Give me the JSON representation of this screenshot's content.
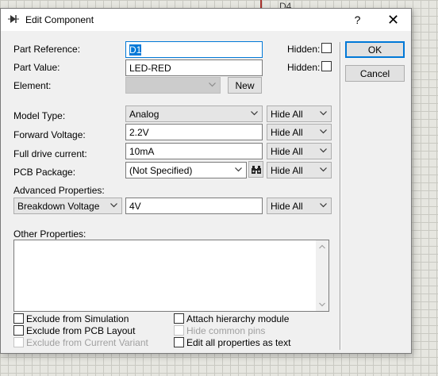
{
  "background": {
    "designator_label": "D4"
  },
  "window": {
    "title": "Edit Component",
    "help_label": "?",
    "close_label": "✕"
  },
  "fields": {
    "part_reference": {
      "label": "Part Reference:",
      "value": "D1",
      "hidden_label": "Hidden:",
      "hidden_checked": false
    },
    "part_value": {
      "label": "Part Value:",
      "value": "LED-RED",
      "hidden_label": "Hidden:",
      "hidden_checked": false
    },
    "element": {
      "label": "Element:",
      "value": "",
      "new_button": "New"
    }
  },
  "properties": [
    {
      "label": "Model Type:",
      "value": "Analog",
      "kind": "combo",
      "visibility": "Hide All"
    },
    {
      "label": "Forward Voltage:",
      "value": "2.2V",
      "kind": "text",
      "visibility": "Hide All"
    },
    {
      "label": "Full drive current:",
      "value": "10mA",
      "kind": "text",
      "visibility": "Hide All"
    },
    {
      "label": "PCB Package:",
      "value": "(Not Specified)",
      "kind": "combo-browse",
      "visibility": "Hide All"
    }
  ],
  "advanced": {
    "section_label": "Advanced Properties:",
    "property": "Breakdown Voltage",
    "value": "4V",
    "visibility": "Hide All"
  },
  "other_properties": {
    "label": "Other Properties:",
    "text": ""
  },
  "options": {
    "exclude_simulation": {
      "label": "Exclude from Simulation",
      "checked": false,
      "enabled": true
    },
    "exclude_pcb": {
      "label": "Exclude from PCB Layout",
      "checked": false,
      "enabled": true
    },
    "exclude_variant": {
      "label": "Exclude from Current Variant",
      "checked": false,
      "enabled": false
    },
    "attach_hierarchy": {
      "label": "Attach hierarchy module",
      "checked": false,
      "enabled": true
    },
    "hide_common_pins": {
      "label": "Hide common pins",
      "checked": false,
      "enabled": false
    },
    "edit_all_properties": {
      "label": "Edit all properties as text",
      "checked": false,
      "enabled": true
    }
  },
  "buttons": {
    "ok": "OK",
    "cancel": "Cancel"
  },
  "colors": {
    "accent": "#0078d7",
    "window_bg": "#f0f0f0",
    "wire": "#a8322d"
  },
  "icons": [
    "diode-icon",
    "binoculars-icon",
    "chevron-down-icon",
    "close-icon"
  ]
}
